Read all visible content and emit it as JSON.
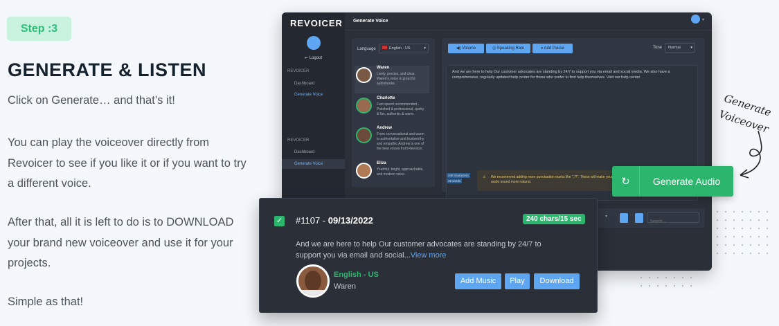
{
  "left": {
    "step": "Step :3",
    "heading": "GENERATE & LISTEN",
    "p1": "Click on Generate… and that’s it!",
    "p2": "You can play the voiceover directly from Revoicer to see if you like it or if you want to try a different voice.",
    "p3": "After that, all it is left to do is to DOWNLOAD your brand new voiceover and use it for your projects.",
    "p4": "Simple as that!"
  },
  "app": {
    "logo": "REVOICER",
    "page_title": "Generate Voice",
    "logout": "Logout",
    "section1": "REVOICER",
    "section2": "REVOICER",
    "nav": [
      "Dashboard",
      "Generate Voice",
      "Dashboard",
      "Generate Voice"
    ],
    "language_label": "Language",
    "language_value": "English - US",
    "voices": [
      {
        "name": "Waren",
        "desc": "Lively, precise, and clear. Waren's voice is great for audiobooks."
      },
      {
        "name": "Charlotte",
        "desc": "Fast speed recommended - Polished & professional, quirky & fun, authentic & warm."
      },
      {
        "name": "Andrew",
        "desc": "From conversational and warm to authoritative and trustworthy and empathic Andrew is one of the best voices from Revoicer."
      },
      {
        "name": "Eliza",
        "desc": "Youthful, bright, approachable, and modern voice."
      }
    ],
    "toolbar": {
      "volume": "Volume",
      "speaking_rate": "Speaking Rate",
      "add_pause": "Add Pause",
      "tone_label": "Tone",
      "tone_value": "Normal"
    },
    "text": "And we are here to help Our customer advocates are standing by 24/7 to support you via email and social media. We also have a comprehensive, regularly updated help center for those who prefer to find help themselves. Visit our help center",
    "counts": [
      "240 characters",
      "42 words"
    ],
    "warning": "We recommend adding more punctuation marks like \",?!\". These will make your audio sound more natural.",
    "search_placeholder": "Search..."
  },
  "generate": {
    "label": "Generate Audio",
    "annotation": "Generate Voiceover"
  },
  "card": {
    "id": "#1107 - ",
    "date": "09/13/2022",
    "badge": "240 chars/15 sec",
    "text": "And we are here to help Our customer advocates are standing by 24/7 to support you via email and social...",
    "view_more": "View more",
    "language": "English - US",
    "voice": "Waren",
    "buttons": {
      "music": "Add Music",
      "play": "Play",
      "download": "Download"
    }
  },
  "colors": {
    "accent_green": "#2cb56c",
    "accent_blue": "#5ea5f2",
    "panel_dark": "#2a2f38"
  }
}
